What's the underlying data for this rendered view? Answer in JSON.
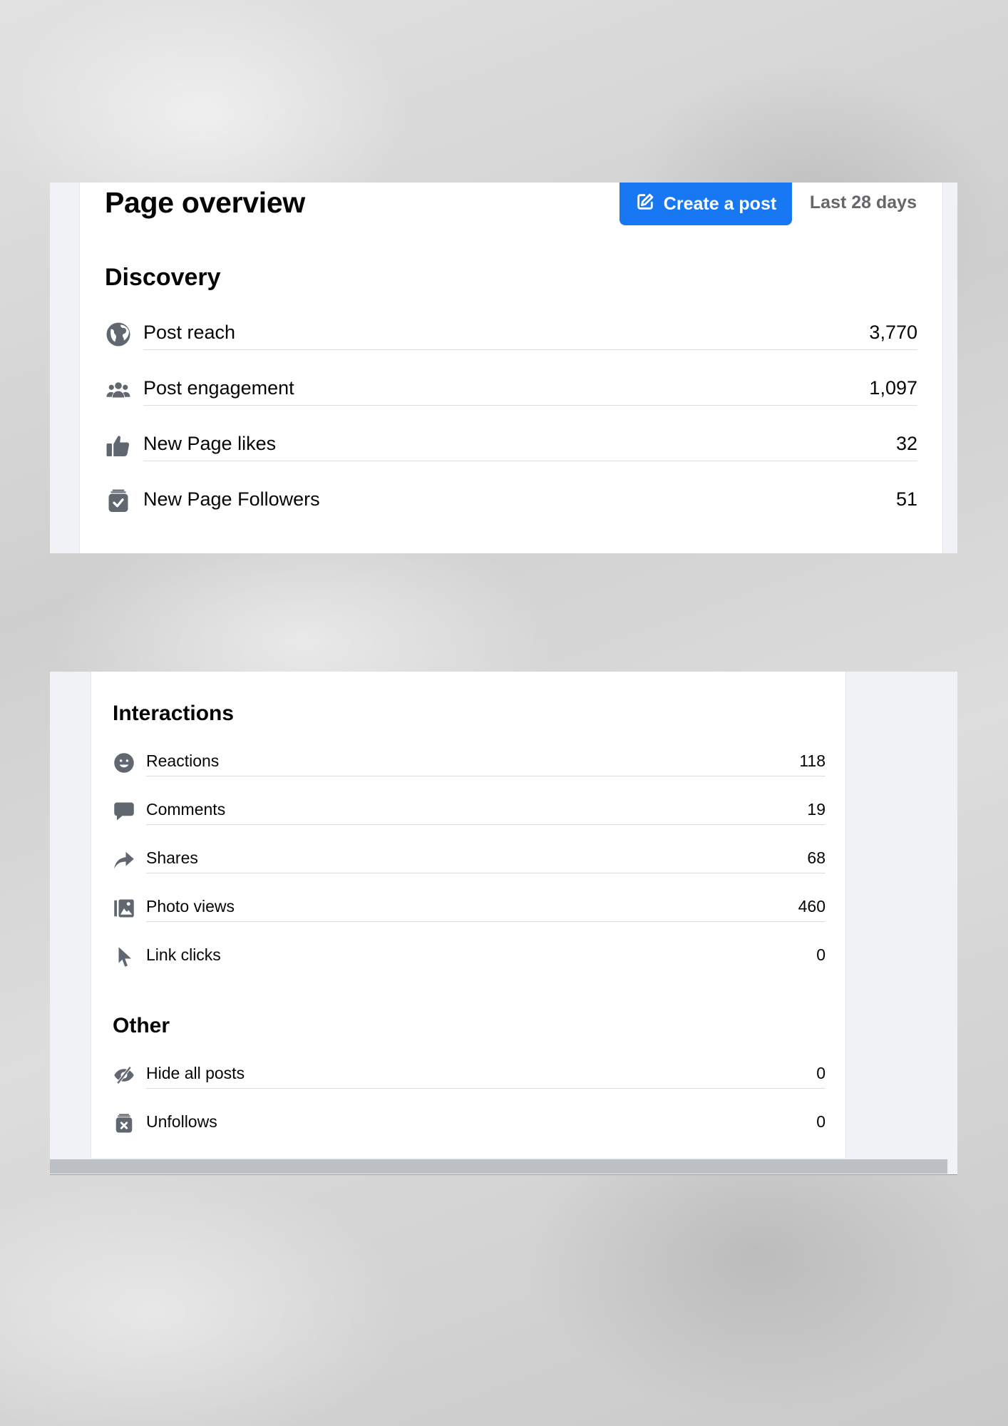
{
  "header": {
    "title": "Page overview",
    "create_post_label": "Create a post",
    "date_range": "Last 28 days",
    "accent_color": "#1877f2"
  },
  "discovery": {
    "title": "Discovery",
    "rows": [
      {
        "icon": "globe-icon",
        "label": "Post reach",
        "value": "3,770"
      },
      {
        "icon": "people-icon",
        "label": "Post engagement",
        "value": "1,097"
      },
      {
        "icon": "thumbs-up-icon",
        "label": "New Page likes",
        "value": "32"
      },
      {
        "icon": "follow-check-icon",
        "label": "New Page Followers",
        "value": "51"
      }
    ]
  },
  "interactions": {
    "title": "Interactions",
    "rows": [
      {
        "icon": "smile-icon",
        "label": "Reactions",
        "value": "118"
      },
      {
        "icon": "comment-icon",
        "label": "Comments",
        "value": "19"
      },
      {
        "icon": "share-icon",
        "label": "Shares",
        "value": "68"
      },
      {
        "icon": "photo-icon",
        "label": "Photo views",
        "value": "460"
      },
      {
        "icon": "cursor-icon",
        "label": "Link clicks",
        "value": "0"
      }
    ]
  },
  "other": {
    "title": "Other",
    "rows": [
      {
        "icon": "hidden-eye-icon",
        "label": "Hide all posts",
        "value": "0"
      },
      {
        "icon": "unfollow-x-icon",
        "label": "Unfollows",
        "value": "0"
      }
    ]
  }
}
